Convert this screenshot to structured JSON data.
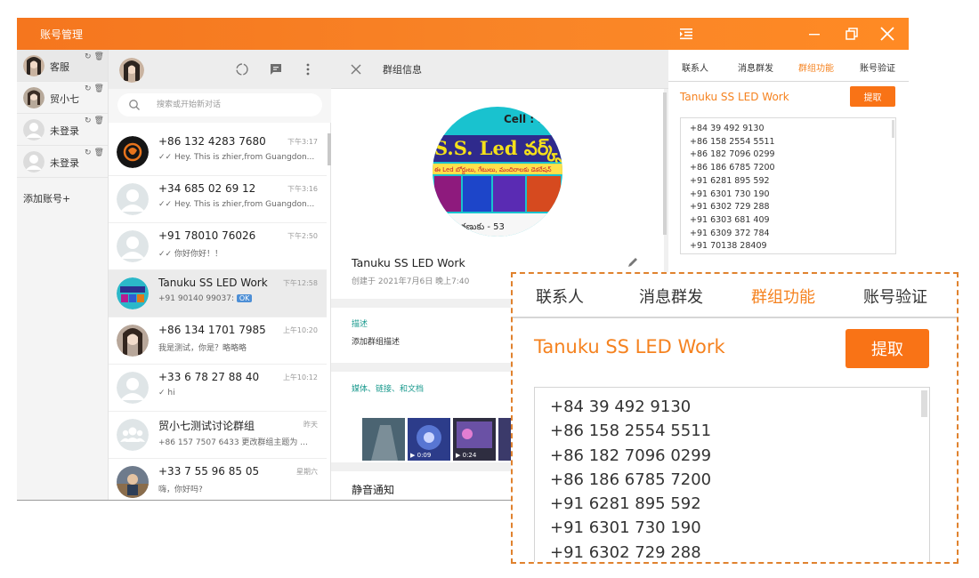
{
  "app": {
    "title": "账号管理"
  },
  "accounts": [
    {
      "name": "客服",
      "active": true
    },
    {
      "name": "贸小七",
      "active": false
    },
    {
      "name": "未登录",
      "active": false
    },
    {
      "name": "未登录",
      "active": false
    }
  ],
  "add_account_label": "添加账号+",
  "search": {
    "placeholder": "搜索或开始新对话"
  },
  "chats": [
    {
      "name": "+86 132 4283 7680",
      "time": "下午3:17",
      "preview": "✓✓ Hey. This is zhier,from Guangdon...",
      "avatar": "emblem"
    },
    {
      "name": "+34 685 02 69 12",
      "time": "下午3:16",
      "preview": "✓✓ Hey. This is zhier,from Guangdon...",
      "avatar": "default"
    },
    {
      "name": "+91 78010 76026",
      "time": "下午2:50",
      "preview": "✓✓ 你好你好！！",
      "avatar": "default"
    },
    {
      "name": "Tanuku SS LED Work",
      "time": "下午12:58",
      "preview": "+91 90140 99037: ",
      "badge": "OK",
      "avatar": "led",
      "active": true
    },
    {
      "name": "+86 134 1701 7985",
      "time": "上午10:20",
      "preview": "我是测试，你是？略略略",
      "avatar": "girl"
    },
    {
      "name": "+33 6 78 27 88 40",
      "time": "上午10:12",
      "preview": "✓ hi",
      "avatar": "default"
    },
    {
      "name": "贸小七测试讨论群组",
      "time": "昨天",
      "preview": "+86 157 7507 6433 更改群组主题为 ...",
      "avatar": "group"
    },
    {
      "name": "+33 7 55 96 85 05",
      "time": "星期六",
      "preview": "嗨，你好吗?",
      "avatar": "photo"
    }
  ],
  "group_info": {
    "header": "群组信息",
    "picture_text": {
      "line1": "Cell : 9",
      "line2": "S.S. Led వర్క్స్",
      "line3": "ఈ Led బోర్డులు, గేటులు, మందిరాలకు డెకరేషన్",
      "line4": "తణుకు - 53"
    },
    "name": "Tanuku SS LED Work",
    "created": "创建于 2021年7月6日 晚上7:40",
    "desc_label": "描述",
    "desc_text": "添加群组描述",
    "media_label": "媒体、链接、和文档",
    "media": [
      {
        "type": "image",
        "duration": ""
      },
      {
        "type": "video",
        "duration": "0:09"
      },
      {
        "type": "video",
        "duration": "0:24"
      },
      {
        "type": "video",
        "duration": ""
      }
    ],
    "mute_label": "静音通知"
  },
  "tool": {
    "tabs": [
      "联系人",
      "消息群发",
      "群组功能",
      "账号验证"
    ],
    "active_tab": "群组功能",
    "group_name": "Tanuku SS LED Work",
    "fetch_label": "提取",
    "phones": [
      "+84 39 492 9130",
      "+86 158 2554 5511",
      "+86 182 7096 0299",
      "+86 186 6785 7200",
      "+91 6281 895 592",
      "+91 6301 730 190",
      "+91 6302 729 288",
      "+91 6303 681 409",
      "+91 6309 372 784",
      "+91 70138 28409"
    ]
  },
  "zoom": {
    "tabs": [
      "联系人",
      "消息群发",
      "群组功能",
      "账号验证"
    ],
    "group_name": "Tanuku SS LED Work",
    "fetch_label": "提取",
    "phones": [
      "+84 39 492 9130",
      "+86 158 2554 5511",
      "+86 182 7096 0299",
      "+86 186 6785 7200",
      "+91 6281 895 592",
      "+91 6301 730 190",
      "+91 6302 729 288"
    ]
  },
  "colors": {
    "brand": "#f5761e",
    "accent_text": "#f5821f",
    "button": "#f97316",
    "teal_label": "#1a9a8e"
  }
}
